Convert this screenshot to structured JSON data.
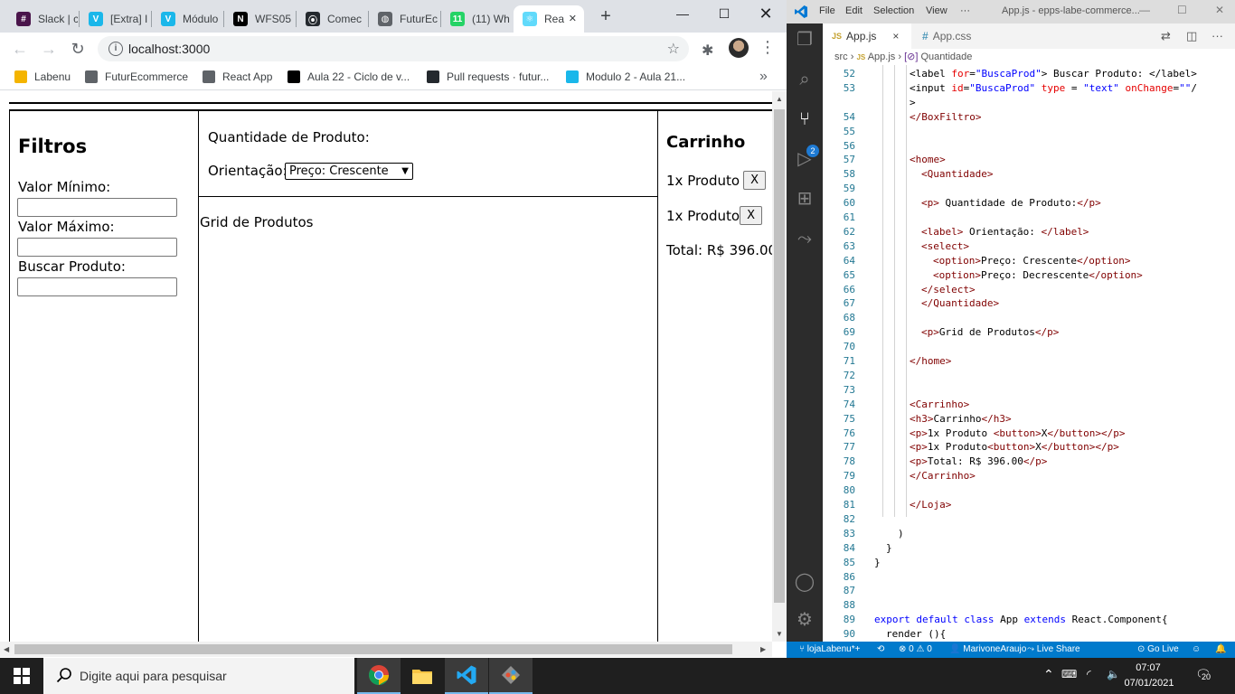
{
  "chrome": {
    "tabs": [
      {
        "title": "Slack | c",
        "color": "#4a154b",
        "glyph": "#"
      },
      {
        "title": "[Extra] I",
        "color": "#1ab7ea",
        "glyph": "V"
      },
      {
        "title": "Módulo",
        "color": "#1ab7ea",
        "glyph": "V"
      },
      {
        "title": "WFS05",
        "color": "#000000",
        "glyph": "N"
      },
      {
        "title": "Comec",
        "color": "#24292e",
        "glyph": "⦿"
      },
      {
        "title": "FuturEc",
        "color": "#5f6368",
        "glyph": "◍"
      },
      {
        "title": "(11) Wh",
        "color": "#25d366",
        "glyph": "11"
      },
      {
        "title": "Rea",
        "color": "#61dafb",
        "glyph": "⚛"
      }
    ],
    "new_tab": "+",
    "url": "localhost:3000",
    "bookmarks": [
      {
        "label": "Labenu",
        "color": "#f4b400"
      },
      {
        "label": "FuturEcommerce",
        "color": "#5f6368"
      },
      {
        "label": "React App",
        "color": "#5f6368"
      },
      {
        "label": "Aula 22 - Ciclo de v...",
        "color": "#000000"
      },
      {
        "label": "Pull requests · futur...",
        "color": "#24292e"
      },
      {
        "label": "Modulo 2 - Aula 21...",
        "color": "#1ab7ea"
      }
    ],
    "bookmarks_more": "»"
  },
  "page": {
    "filtros_title": "Filtros",
    "valor_min_label": "Valor Mínimo:",
    "valor_max_label": "Valor Máximo:",
    "buscar_label": "Buscar Produto:",
    "quantidade_label": "Quantidade de Produto:",
    "orientacao_label": "Orientação:",
    "orientacao_selected": "Preço: Crescente",
    "grid_label": "Grid de Produtos",
    "carrinho_title": "Carrinho",
    "cart_items": [
      {
        "label": "1x Produto ",
        "button": "X"
      },
      {
        "label": "1x Produto",
        "button": "X"
      }
    ],
    "total": "Total: R$ 396.00"
  },
  "vscode": {
    "menu": [
      "File",
      "Edit",
      "Selection",
      "View",
      "···"
    ],
    "window_title": "App.js - epps-labe-commerce...",
    "tabs": [
      {
        "label": "App.js",
        "kind": "JS",
        "close": "×"
      },
      {
        "label": "App.css",
        "kind": "#"
      }
    ],
    "breadcrumb": [
      "src",
      "App.js",
      "Quantidade"
    ],
    "breadcrumb_sep": "›",
    "scm_badge": "2",
    "lines": [
      {
        "n": "52",
        "indent": 3,
        "html": "<span class='t'>&lt;label</span> <span class='a'>for</span><span class='t'>=</span><span class='s'>\"BuscaProd\"</span><span class='t'>&gt; Buscar Produto: &lt;/label&gt;</span>"
      },
      {
        "n": "53",
        "indent": 3,
        "html": "<span class='t'>&lt;input</span> <span class='a'>id</span><span class='t'>=</span><span class='s'>\"BuscaProd\"</span> <span class='a'>type</span> <span class='t'>=</span> <span class='s'>\"text\"</span> <span class='a'>onChange</span><span class='t'>=</span><span class='s'>\"\"</span><span class='t'>/</span>"
      },
      {
        "n": "",
        "indent": 3,
        "html": "<span class='t'>&gt;</span>"
      },
      {
        "n": "54",
        "indent": 3,
        "html": "&lt;/BoxFiltro&gt;"
      },
      {
        "n": "55",
        "indent": 3,
        "html": ""
      },
      {
        "n": "56",
        "indent": 3,
        "html": ""
      },
      {
        "n": "57",
        "indent": 3,
        "html": "&lt;home&gt;"
      },
      {
        "n": "58",
        "indent": 4,
        "html": "&lt;Quantidade&gt;"
      },
      {
        "n": "59",
        "indent": 4,
        "html": ""
      },
      {
        "n": "60",
        "indent": 4,
        "html": "&lt;p&gt;<span class='t'> Quantidade de Produto:</span>&lt;/p&gt;"
      },
      {
        "n": "61",
        "indent": 4,
        "html": ""
      },
      {
        "n": "62",
        "indent": 4,
        "html": "&lt;label&gt;<span class='t'> Orientação: </span>&lt;/label&gt;"
      },
      {
        "n": "63",
        "indent": 4,
        "html": "&lt;select&gt;"
      },
      {
        "n": "64",
        "indent": 5,
        "html": "&lt;option&gt;<span class='t'>Preço: Crescente</span>&lt;/option&gt;"
      },
      {
        "n": "65",
        "indent": 5,
        "html": "&lt;option&gt;<span class='t'>Preço: Decrescente</span>&lt;/option&gt;"
      },
      {
        "n": "66",
        "indent": 4,
        "html": "&lt;/select&gt;"
      },
      {
        "n": "67",
        "indent": 4,
        "html": "&lt;/Quantidade&gt;"
      },
      {
        "n": "68",
        "indent": 4,
        "html": ""
      },
      {
        "n": "69",
        "indent": 4,
        "html": "&lt;p&gt;<span class='t'>Grid de Produtos</span>&lt;/p&gt;"
      },
      {
        "n": "70",
        "indent": 4,
        "html": ""
      },
      {
        "n": "71",
        "indent": 3,
        "html": "&lt;/home&gt;"
      },
      {
        "n": "72",
        "indent": 3,
        "html": ""
      },
      {
        "n": "73",
        "indent": 3,
        "html": ""
      },
      {
        "n": "74",
        "indent": 3,
        "html": "&lt;Carrinho&gt;"
      },
      {
        "n": "75",
        "indent": 3,
        "html": "&lt;h3&gt;<span class='t'>Carrinho</span>&lt;/h3&gt;"
      },
      {
        "n": "76",
        "indent": 3,
        "html": "&lt;p&gt;<span class='t'>1x Produto </span>&lt;button&gt;<span class='t'>X</span>&lt;/button&gt;&lt;/p&gt;"
      },
      {
        "n": "77",
        "indent": 3,
        "html": "&lt;p&gt;<span class='t'>1x Produto</span>&lt;button&gt;<span class='t'>X</span>&lt;/button&gt;&lt;/p&gt;"
      },
      {
        "n": "78",
        "indent": 3,
        "html": "&lt;p&gt;<span class='t'>Total: R$ 396.00</span>&lt;/p&gt;"
      },
      {
        "n": "79",
        "indent": 3,
        "html": "&lt;/Carrinho&gt;"
      },
      {
        "n": "80",
        "indent": 3,
        "html": ""
      },
      {
        "n": "81",
        "indent": 3,
        "html": "&lt;/Loja&gt;"
      },
      {
        "n": "82",
        "indent": 3,
        "html": ""
      },
      {
        "n": "83",
        "indent": 2,
        "html": "<span class='t'>)</span>"
      },
      {
        "n": "84",
        "indent": 1,
        "html": "<span class='t'>}</span>"
      },
      {
        "n": "85",
        "indent": 0,
        "html": "<span class='t'>}</span>"
      },
      {
        "n": "86",
        "indent": 0,
        "html": ""
      },
      {
        "n": "87",
        "indent": 0,
        "html": ""
      },
      {
        "n": "88",
        "indent": 0,
        "html": ""
      },
      {
        "n": "89",
        "indent": 0,
        "html": "<span class='k'>export</span> <span class='k'>default</span> <span class='k'>class</span> <span class='t'>App</span> <span class='k'>extends</span> <span class='t'>React.Component{</span>"
      },
      {
        "n": "90",
        "indent": 1,
        "html": "<span class='t'>render (){</span>"
      }
    ],
    "status": {
      "branch": "lojaLabenu*+",
      "problems": "⊗ 0 ⚠ 0",
      "user": "MarivoneAraujo",
      "live_share": "Live Share",
      "go_live": "Go Live"
    }
  },
  "taskbar": {
    "search_placeholder": "Digite aqui para pesquisar",
    "time": "07:07",
    "date": "07/01/2021",
    "notifications": "20"
  }
}
